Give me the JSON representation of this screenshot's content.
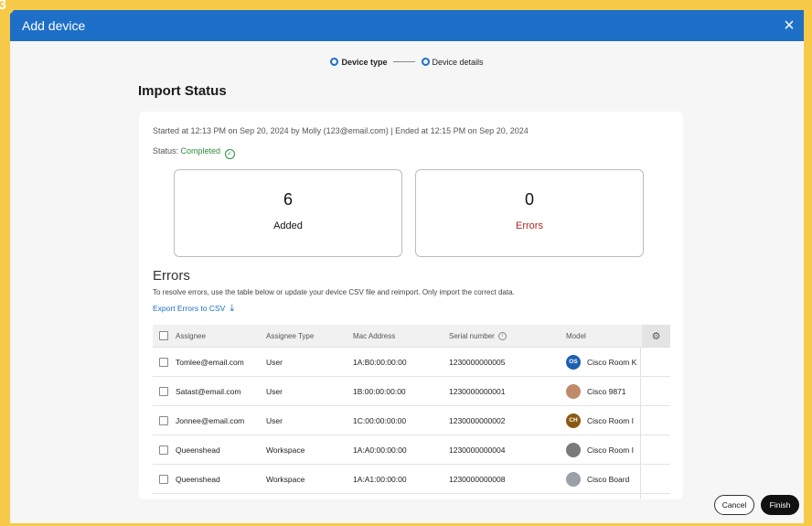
{
  "window": {
    "title": "Add device",
    "close_glyph": "×"
  },
  "badge": "3",
  "stepper": {
    "step1": "Device type",
    "step2": "Device details"
  },
  "page_title": "Import Status",
  "summary": {
    "meta": "Started at 12:13 PM on Sep 20, 2024 by Molly (123@email.com) | Ended at 12:15 PM on Sep 20, 2024",
    "status_label": "Status:",
    "status_value": "Completed",
    "status_icon": "check-circle-icon"
  },
  "stats": {
    "added": {
      "value": "6",
      "label": "Added"
    },
    "errors": {
      "value": "0",
      "label": "Errors"
    }
  },
  "errors_section": {
    "heading": "Errors",
    "description": "To resolve errors, use the table below or update your device CSV file and reimport. Only import the correct data.",
    "export_label": "Export Errors to CSV",
    "export_icon": "download-icon"
  },
  "table": {
    "headers": [
      "Assignee",
      "Assignee Type",
      "Mac Address",
      "Serial number",
      "Model"
    ],
    "settings_icon": "gear-icon",
    "rows": [
      {
        "assignee": "Tomlee@email.com",
        "type": "User",
        "mac": "1A:B0:00:00:00",
        "serial": "1230000000005",
        "model": "Cisco Room K",
        "avatar_text": "OS",
        "avatar_color": "#1d5fb0"
      },
      {
        "assignee": "Satast@email.com",
        "type": "User",
        "mac": "1B:00:00:00:00",
        "serial": "1230000000001",
        "model": "Cisco 9871",
        "avatar_text": "",
        "avatar_color": "#c08a6a"
      },
      {
        "assignee": "Jonnee@email.com",
        "type": "User",
        "mac": "1C:00:00:00:00",
        "serial": "1230000000002",
        "model": "Cisco Room I",
        "avatar_text": "CH",
        "avatar_color": "#8a5a12"
      },
      {
        "assignee": "Queenshead",
        "type": "Workspace",
        "mac": "1A:A0:00:00:00",
        "serial": "1230000000004",
        "model": "Cisco Room I",
        "avatar_text": "",
        "avatar_color": "#7a7a7a"
      },
      {
        "assignee": "Queenshead",
        "type": "Workspace",
        "mac": "1A:A1:00:00:00",
        "serial": "1230000000008",
        "model": "Cisco Board",
        "avatar_text": "",
        "avatar_color": "#9aa0a8"
      }
    ]
  },
  "footer": {
    "cancel": "Cancel",
    "finish": "Finish"
  },
  "colors": {
    "accent": "#1d6fc8",
    "success": "#2e8b3a",
    "error": "#b3241f",
    "frame": "#f7c948"
  }
}
